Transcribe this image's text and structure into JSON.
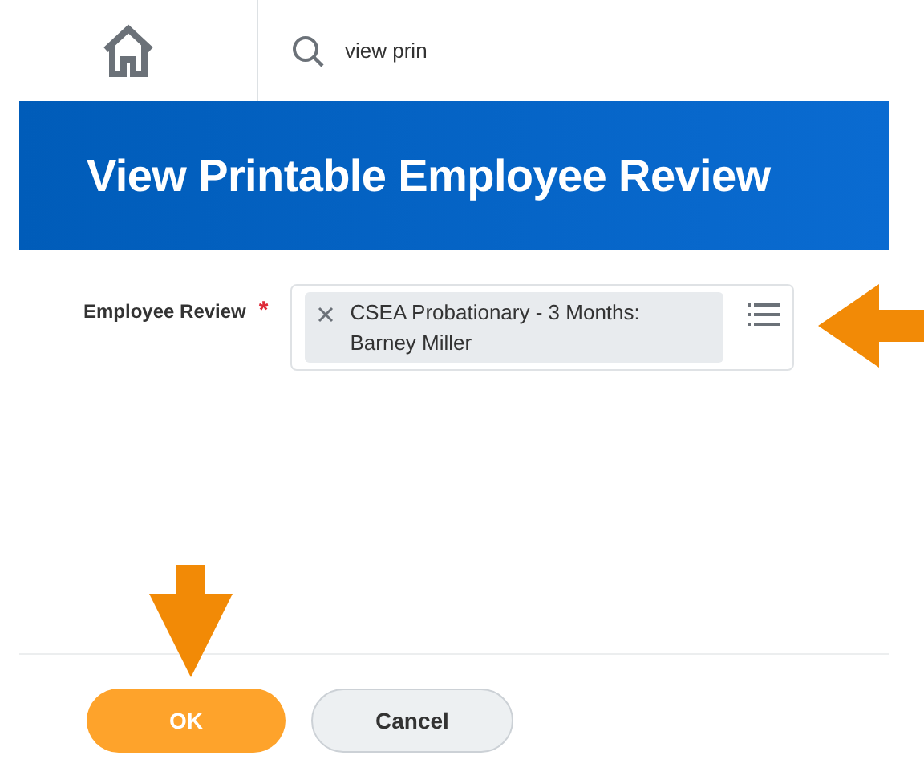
{
  "search": {
    "value": "view prin"
  },
  "header": {
    "title": "View Printable Employee Review"
  },
  "form": {
    "fields": [
      {
        "label": "Employee Review",
        "required": true,
        "required_mark": "*",
        "values": [
          {
            "text": "CSEA Probationary - 3 Months: Barney Miller"
          }
        ]
      }
    ]
  },
  "buttons": [
    {
      "label": "OK",
      "kind": "primary"
    },
    {
      "label": "Cancel",
      "kind": "secondary"
    }
  ]
}
